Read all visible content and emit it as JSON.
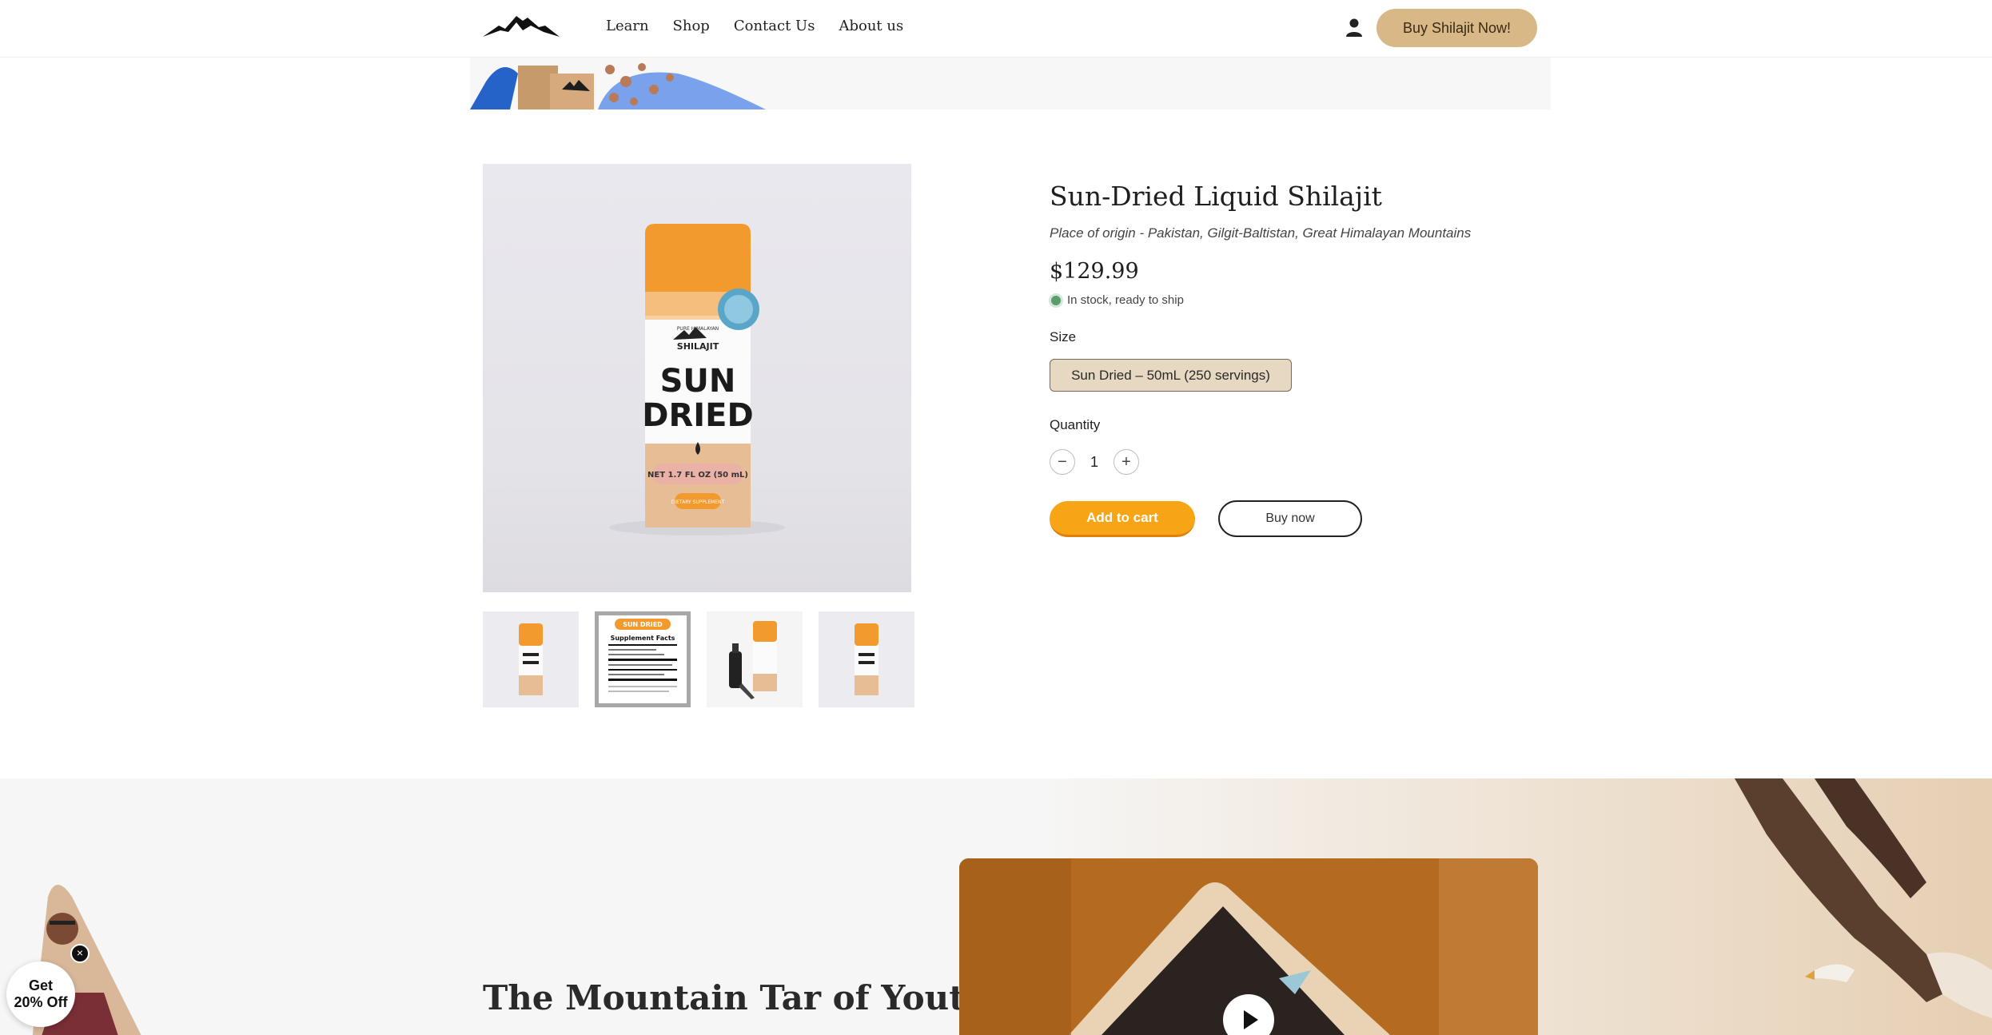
{
  "header": {
    "nav": [
      "Learn",
      "Shop",
      "Contact Us",
      "About us"
    ],
    "cta_label": "Buy Shilajit Now!"
  },
  "product": {
    "title": "Sun-Dried Liquid Shilajit",
    "origin": "Place of origin - Pakistan, Gilgit-Baltistan, Great Himalayan Mountains",
    "price": "$129.99",
    "stock": "In stock, ready to ship",
    "size_label": "Size",
    "size_option": "Sun Dried – 50mL (250 servings)",
    "quantity_label": "Quantity",
    "quantity_value": "1",
    "add_to_cart": "Add to cart",
    "buy_now": "Buy now"
  },
  "packaging": {
    "brand_top": "PURE HIMALAYAN",
    "brand": "SHILAJIT",
    "name_line1": "SUN",
    "name_line2": "DRIED",
    "volume": "NET 1.7 FL OZ (50 mL)",
    "supplement": "DIETARY SUPPLEMENT"
  },
  "thumbnails": {
    "label_title": "SUN DRIED",
    "label_facts": "Supplement Facts"
  },
  "section": {
    "title": "The Mountain Tar of Youth"
  },
  "popup": {
    "line1": "Get",
    "line2": "20% Off",
    "close": "×"
  },
  "colors": {
    "accent_orange": "#f7a514",
    "cta_tan": "#d9b888",
    "stock_green": "#5c9d6e",
    "size_pill": "#e6d8c1"
  },
  "icons": [
    "mountain-logo-icon",
    "user-icon",
    "minus-icon",
    "plus-icon",
    "play-icon",
    "close-icon"
  ]
}
